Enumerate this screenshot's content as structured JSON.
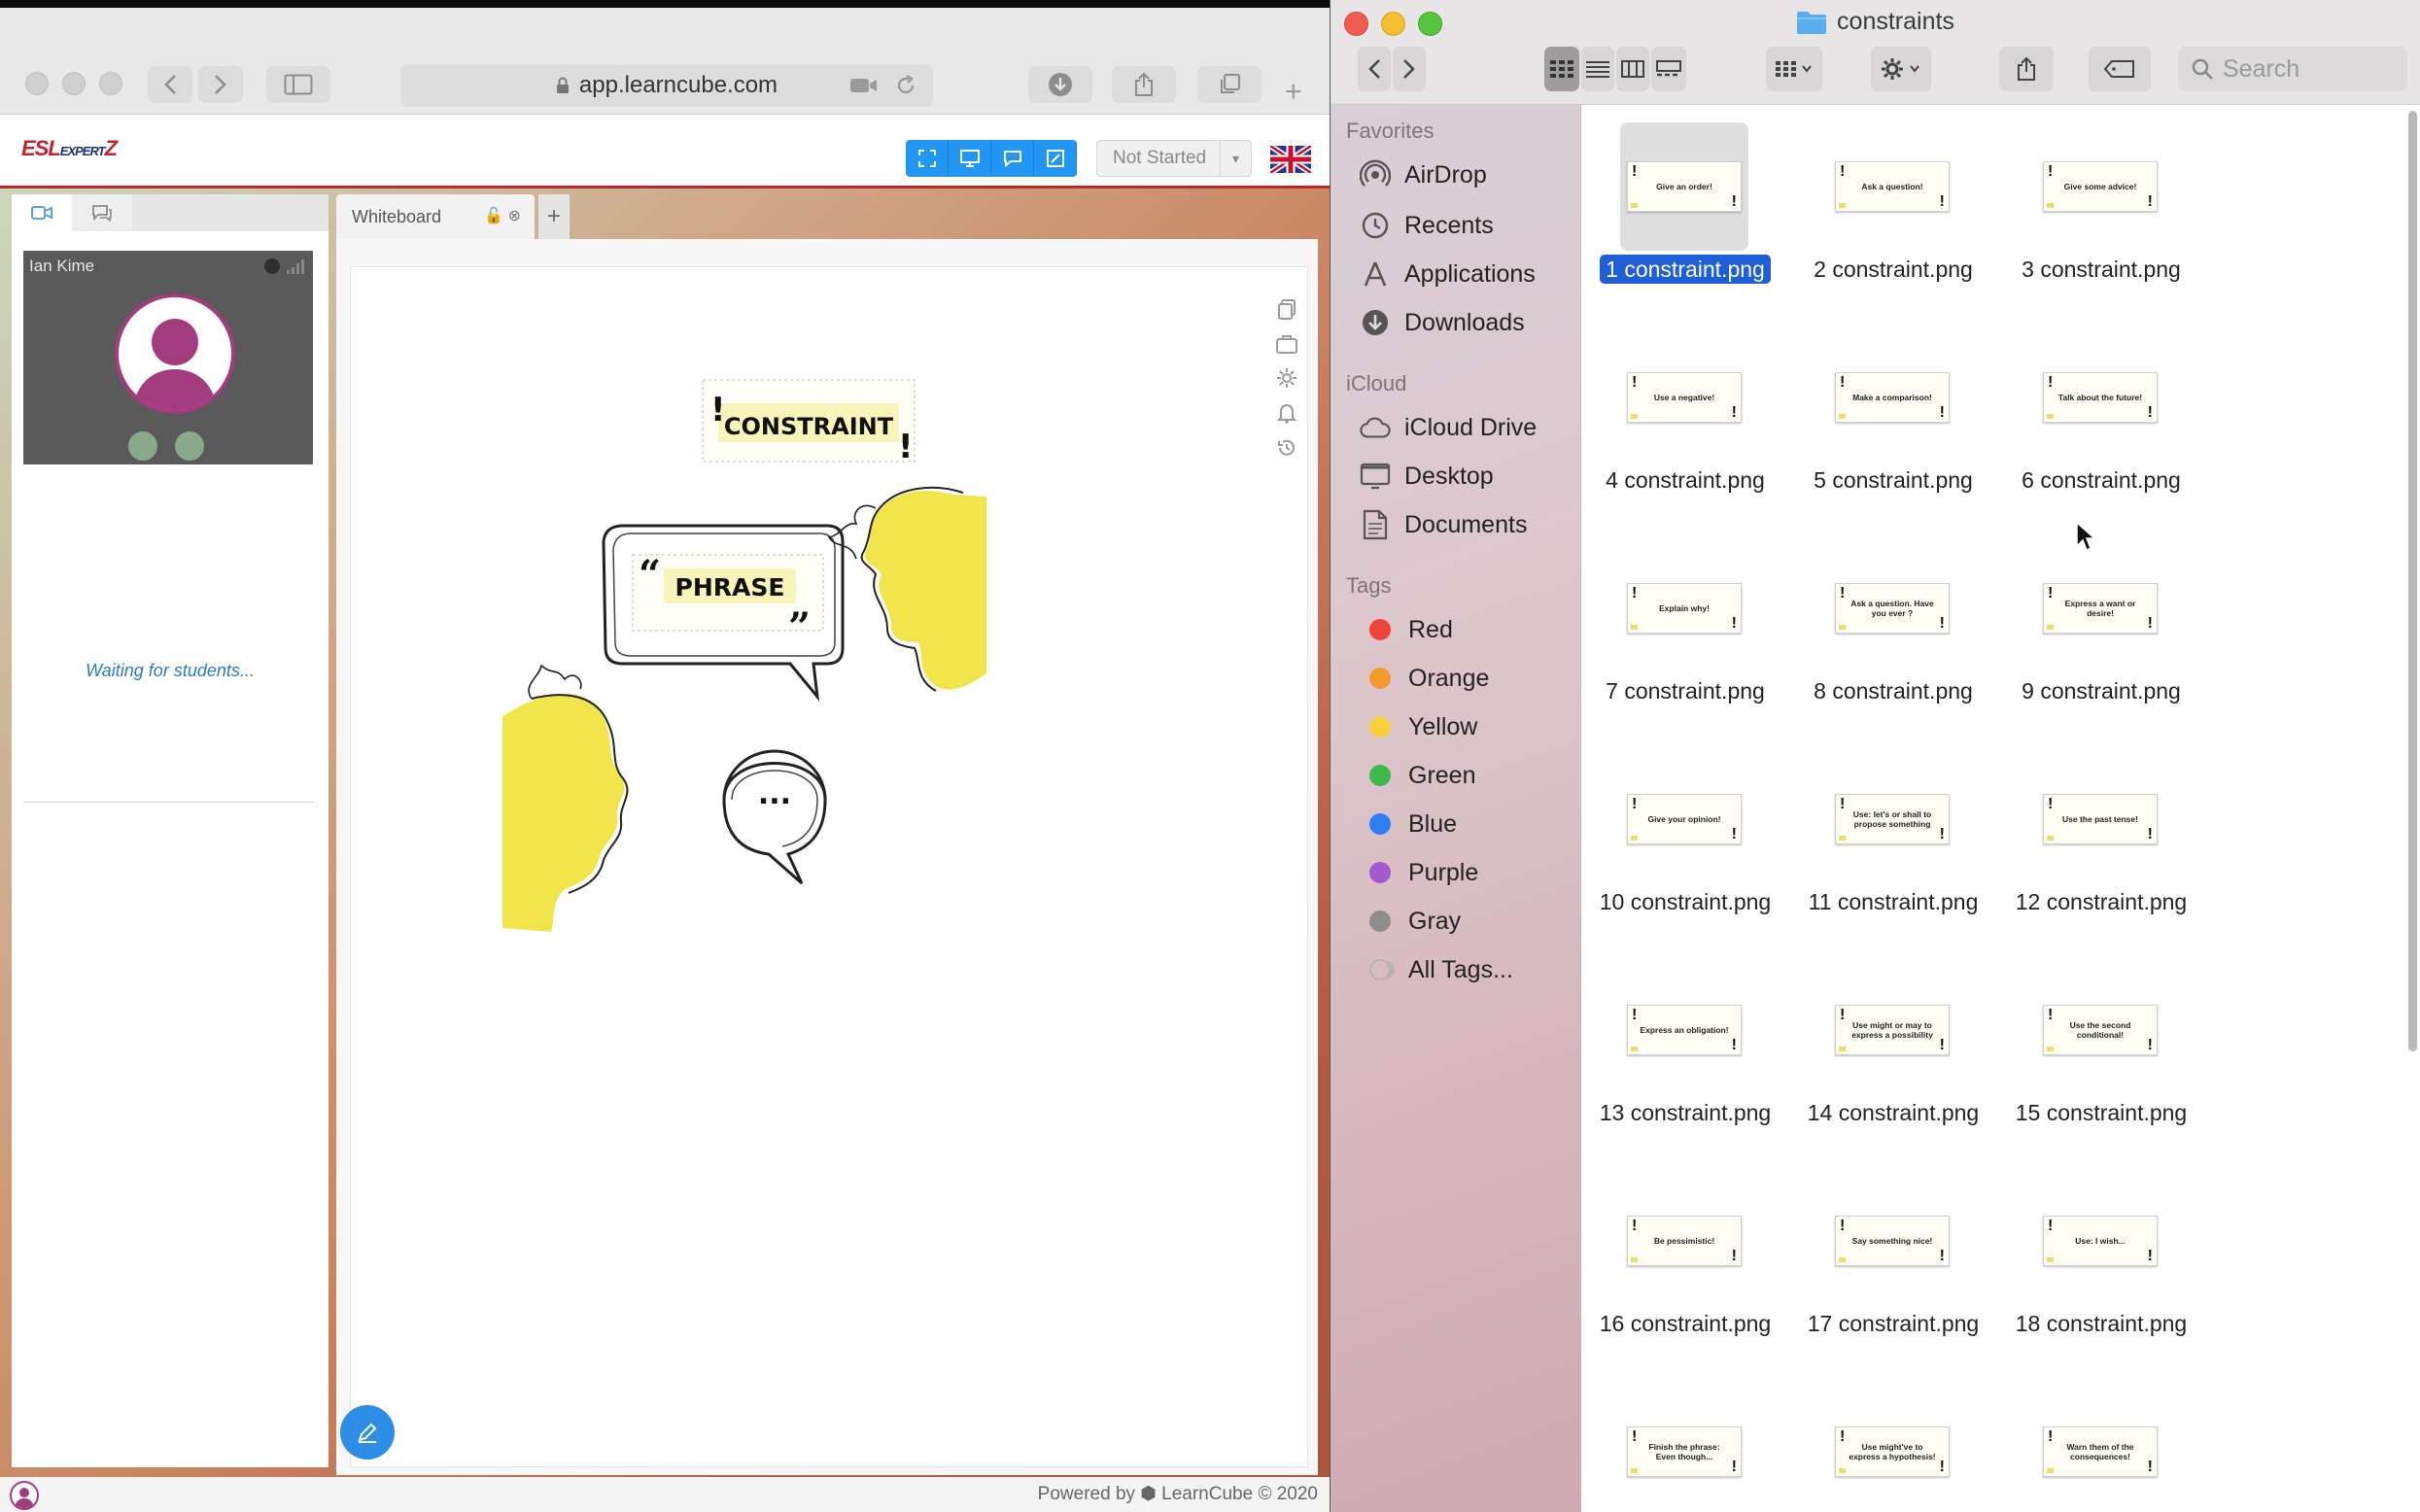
{
  "browser": {
    "url": "app.learncube.com",
    "logo": "ESL",
    "logo_sub": "EXPERT",
    "status": "Not Started",
    "participant_name": "Ian Kime",
    "waiting_text": "Waiting for students...",
    "whiteboard_tab": "Whiteboard",
    "add_tab": "+",
    "board_title": "CONSTRAINT",
    "board_phrase": "PHRASE",
    "board_dots": "...",
    "powered_by": "Powered by ⬢ LearnCube © 2020",
    "colors": {
      "accent": "#2196f3",
      "header_rule": "#c02727",
      "avatar_ring": "#a33b7f",
      "speaker_fill": "#f2e54b"
    }
  },
  "finder": {
    "title": "constraints",
    "search_placeholder": "Search",
    "favorites_heading": "Favorites",
    "favorites": [
      {
        "label": "AirDrop",
        "icon": "airdrop-icon"
      },
      {
        "label": "Recents",
        "icon": "clock-icon"
      },
      {
        "label": "Applications",
        "icon": "applications-icon"
      },
      {
        "label": "Downloads",
        "icon": "download-icon"
      }
    ],
    "icloud_heading": "iCloud",
    "icloud": [
      {
        "label": "iCloud Drive",
        "icon": "cloud-icon"
      },
      {
        "label": "Desktop",
        "icon": "desktop-icon"
      },
      {
        "label": "Documents",
        "icon": "document-icon"
      }
    ],
    "tags_heading": "Tags",
    "tags": [
      {
        "label": "Red",
        "color": "#f0453a"
      },
      {
        "label": "Orange",
        "color": "#f59a2f"
      },
      {
        "label": "Yellow",
        "color": "#f6cf3b"
      },
      {
        "label": "Green",
        "color": "#3fb94b"
      },
      {
        "label": "Blue",
        "color": "#2f7cf6"
      },
      {
        "label": "Purple",
        "color": "#a35ad1"
      },
      {
        "label": "Gray",
        "color": "#8e8e8e"
      },
      {
        "label": "All Tags...",
        "color": "#b8b2b4"
      }
    ],
    "files": [
      {
        "name": "1 constraint.png",
        "thumb": "Give an order!",
        "selected": true
      },
      {
        "name": "2 constraint.png",
        "thumb": "Ask a question!"
      },
      {
        "name": "3 constraint.png",
        "thumb": "Give some advice!"
      },
      {
        "name": "4 constraint.png",
        "thumb": "Use a negative!"
      },
      {
        "name": "5 constraint.png",
        "thumb": "Make a comparison!"
      },
      {
        "name": "6 constraint.png",
        "thumb": "Talk about the future!"
      },
      {
        "name": "7 constraint.png",
        "thumb": "Explain why!"
      },
      {
        "name": "8 constraint.png",
        "thumb": "Ask a question. Have you ever ?"
      },
      {
        "name": "9 constraint.png",
        "thumb": "Express a want or desire!"
      },
      {
        "name": "10 constraint.png",
        "thumb": "Give your opinion!"
      },
      {
        "name": "11 constraint.png",
        "thumb": "Use: let's or shall to propose something"
      },
      {
        "name": "12 constraint.png",
        "thumb": "Use the past tense!"
      },
      {
        "name": "13 constraint.png",
        "thumb": "Express an obligation!"
      },
      {
        "name": "14 constraint.png",
        "thumb": "Use might or may to express a possibility"
      },
      {
        "name": "15 constraint.png",
        "thumb": "Use the second conditional!"
      },
      {
        "name": "16 constraint.png",
        "thumb": "Be pessimistic!"
      },
      {
        "name": "17 constraint.png",
        "thumb": "Say something nice!"
      },
      {
        "name": "18 constraint.png",
        "thumb": "Use: I wish..."
      },
      {
        "name": "",
        "thumb": "Finish the phrase: Even though..."
      },
      {
        "name": "",
        "thumb": "Use might've to express a hypothesis!"
      },
      {
        "name": "",
        "thumb": "Warn them of the consequences!"
      }
    ]
  }
}
